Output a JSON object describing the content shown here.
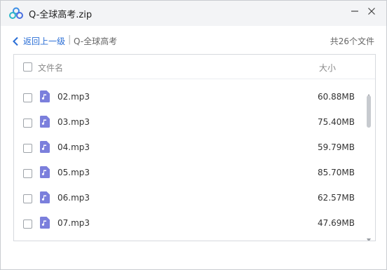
{
  "window": {
    "title": "Q-全球高考.zip"
  },
  "breadcrumb": {
    "back_label": "返回上一级",
    "separator": "|",
    "current": "Q-全球高考",
    "count_text": "共26个文件"
  },
  "list": {
    "header": {
      "name": "文件名",
      "size": "大小"
    },
    "files": [
      {
        "name": "02.mp3",
        "size": "60.88MB"
      },
      {
        "name": "03.mp3",
        "size": "75.40MB"
      },
      {
        "name": "04.mp3",
        "size": "59.79MB"
      },
      {
        "name": "05.mp3",
        "size": "85.70MB"
      },
      {
        "name": "06.mp3",
        "size": "62.57MB"
      },
      {
        "name": "07.mp3",
        "size": "47.69MB"
      }
    ]
  },
  "icons": {
    "logo": "app-logo",
    "minimize": "minimize-icon",
    "close": "close-icon",
    "back": "chevron-left-icon",
    "file": "audio-file-icon"
  },
  "colors": {
    "accent": "#2b6fd6",
    "file_icon": "#7b7fdc",
    "titlebar": "#f3f4f6"
  }
}
